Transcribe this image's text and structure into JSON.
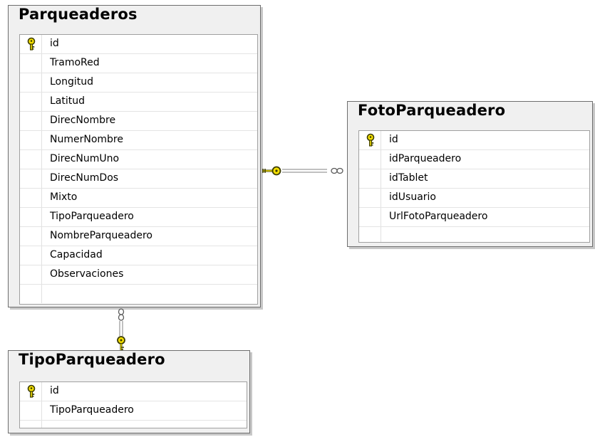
{
  "tables": {
    "parqueaderos": {
      "name": "Parqueaderos",
      "columns": [
        "id",
        "TramoRed",
        "Longitud",
        "Latitud",
        "DirecNombre",
        "NumerNombre",
        "DirecNumUno",
        "DirecNumDos",
        "Mixto",
        "TipoParqueadero",
        "NombreParqueadero",
        "Capacidad",
        "Observaciones"
      ]
    },
    "foto_parqueadero": {
      "name": "FotoParqueadero",
      "columns": [
        "id",
        "idParqueadero",
        "idTablet",
        "idUsuario",
        "UrlFotoParqueadero"
      ]
    },
    "tipo_parqueadero": {
      "name": "TipoParqueadero",
      "columns": [
        "id",
        "TipoParqueadero"
      ]
    }
  },
  "relationships": [
    {
      "from": "Parqueaderos.id",
      "to": "FotoParqueadero.idParqueadero",
      "type": "one-to-many"
    },
    {
      "from": "TipoParqueadero.id",
      "to": "Parqueaderos.TipoParqueadero",
      "type": "one-to-many"
    }
  ],
  "colors": {
    "key_icon": "#f5e000",
    "header_bg": "#f0f0f0",
    "border": "#6e6e6e"
  }
}
